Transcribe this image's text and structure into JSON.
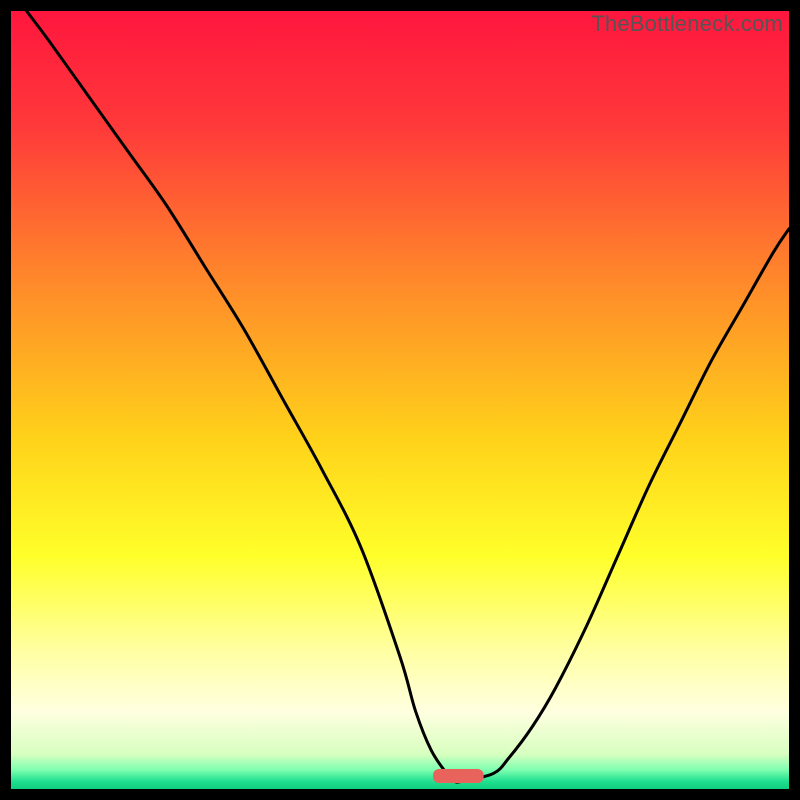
{
  "watermark": "TheBottleneck.com",
  "chart_data": {
    "type": "line",
    "title": "",
    "xlabel": "",
    "ylabel": "",
    "xlim": [
      0,
      100
    ],
    "ylim": [
      0,
      100
    ],
    "gradient_stops": [
      {
        "offset": 0.0,
        "color": "#ff163e"
      },
      {
        "offset": 0.15,
        "color": "#ff3a3a"
      },
      {
        "offset": 0.35,
        "color": "#ff8a2a"
      },
      {
        "offset": 0.55,
        "color": "#ffd21a"
      },
      {
        "offset": 0.7,
        "color": "#ffff2a"
      },
      {
        "offset": 0.82,
        "color": "#ffffa0"
      },
      {
        "offset": 0.9,
        "color": "#ffffe0"
      },
      {
        "offset": 0.955,
        "color": "#d8ffc0"
      },
      {
        "offset": 0.975,
        "color": "#80ffb0"
      },
      {
        "offset": 0.99,
        "color": "#20e090"
      },
      {
        "offset": 1.0,
        "color": "#10d080"
      }
    ],
    "series": [
      {
        "name": "bottleneck-curve",
        "x": [
          2,
          5,
          10,
          15,
          20,
          25,
          30,
          35,
          40,
          45,
          50,
          52,
          54,
          56,
          57,
          58,
          62,
          64,
          67,
          70,
          74,
          78,
          82,
          86,
          90,
          94,
          98,
          100
        ],
        "y": [
          100,
          96,
          89,
          82,
          75,
          67,
          59,
          50,
          41,
          31,
          17,
          10,
          5,
          2,
          1,
          1,
          2,
          4,
          8,
          13,
          21,
          30,
          39,
          47,
          55,
          62,
          69,
          72
        ]
      }
    ],
    "marker": {
      "name": "min-marker",
      "x_center": 57.5,
      "width": 6.5,
      "color": "#e8635c"
    }
  }
}
